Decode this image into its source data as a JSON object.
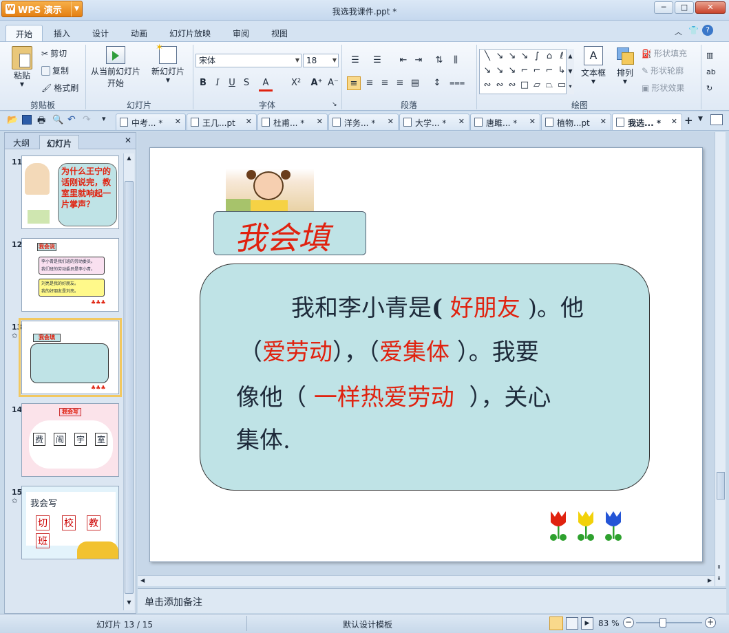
{
  "window": {
    "app_button": "WPS 演示",
    "title": "我选我课件.ppt *"
  },
  "ribbon_tabs": [
    "开始",
    "插入",
    "设计",
    "动画",
    "幻灯片放映",
    "审阅",
    "视图"
  ],
  "ribbon": {
    "clipboard": {
      "paste": "粘贴",
      "cut": "剪切",
      "copy": "复制",
      "format_painter": "格式刷",
      "label": "剪贴板"
    },
    "slides": {
      "from_current": "从当前幻灯片",
      "start": "开始",
      "new_slide": "新幻灯片",
      "label": "幻灯片"
    },
    "font": {
      "name": "宋体",
      "size": "18",
      "label": "字体"
    },
    "paragraph": {
      "label": "段落"
    },
    "drawing": {
      "textbox": "文本框",
      "arrange": "排列",
      "shape_fill": "形状填充",
      "shape_outline": "形状轮廓",
      "shape_effect": "形状效果",
      "label": "绘图"
    }
  },
  "doc_tabs": [
    "中考... *",
    "王几...pt",
    "杜甫... *",
    "洋务... *",
    "大学... *",
    "唐雎... *",
    "植物...pt",
    "我选... *"
  ],
  "left_panel": {
    "tabs": [
      "大纲",
      "幻灯片"
    ],
    "thumbnails": [
      {
        "num": "11",
        "text": "为什么王宁的话刚说完，教室里就响起一片掌声？"
      },
      {
        "num": "12",
        "title": "我会说",
        "line1": "李小青是我们班的劳动委员。",
        "line2": "我们班的劳动委员是李小青。",
        "line3": "刘亮是我的好朋友。",
        "line4": "我的好朋友是刘亮。"
      },
      {
        "num": "13",
        "title": "我会填"
      },
      {
        "num": "14",
        "title": "我会写",
        "chars": [
          "费",
          "闹",
          "宇",
          "室"
        ]
      },
      {
        "num": "15",
        "title": "我会写",
        "chars": [
          "切",
          "校",
          "教",
          "班"
        ]
      }
    ]
  },
  "slide": {
    "heading": "我会填",
    "line1_a": "我和李小青是",
    "line1_paren_open": "(",
    "line1_answer": "好朋友",
    "line1_b": ")。他",
    "line2_open1": "（",
    "line2_answer1": "爱劳动",
    "line2_mid": "），（",
    "line2_answer2": "爱集体",
    "line2_end": "）。我要",
    "line3_a": "像他（",
    "line3_answer": "一样热爱劳动",
    "line3_b": "），关心",
    "line4": "集体."
  },
  "notes_placeholder": "单击添加备注",
  "status": {
    "slide_counter": "幻灯片 13 / 15",
    "template": "默认设计模板",
    "zoom": "83 %"
  }
}
